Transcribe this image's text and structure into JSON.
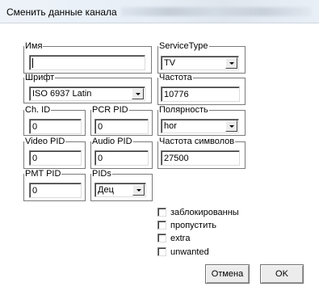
{
  "window": {
    "title": "Сменить данные канала"
  },
  "name_group": {
    "legend": "Имя",
    "value": ""
  },
  "service_type": {
    "legend": "ServiceType",
    "selected": "TV"
  },
  "font_group": {
    "legend": "Шрифт",
    "selected": "ISO 6937 Latin"
  },
  "frequency": {
    "legend": "Частота",
    "value": "10776"
  },
  "ch_id": {
    "legend": "Ch. ID",
    "value": "0"
  },
  "pcr_pid": {
    "legend": "PCR PID",
    "value": "0"
  },
  "polarity": {
    "legend": "Полярность",
    "selected": "hor"
  },
  "video_pid": {
    "legend": "Video PID",
    "value": "0"
  },
  "audio_pid": {
    "legend": "Audio PID",
    "value": "0"
  },
  "symbol_rate": {
    "legend": "Частота символов",
    "value": "27500"
  },
  "pmt_pid": {
    "legend": "PMT PID",
    "value": "0"
  },
  "pids": {
    "legend": "PIDs",
    "selected": "Дец"
  },
  "checkboxes": [
    {
      "label": "заблокированны",
      "checked": false
    },
    {
      "label": "пропустить",
      "checked": false
    },
    {
      "label": "extra",
      "checked": false
    },
    {
      "label": "unwanted",
      "checked": false
    }
  ],
  "buttons": {
    "cancel": "Отмена",
    "ok": "OK"
  }
}
